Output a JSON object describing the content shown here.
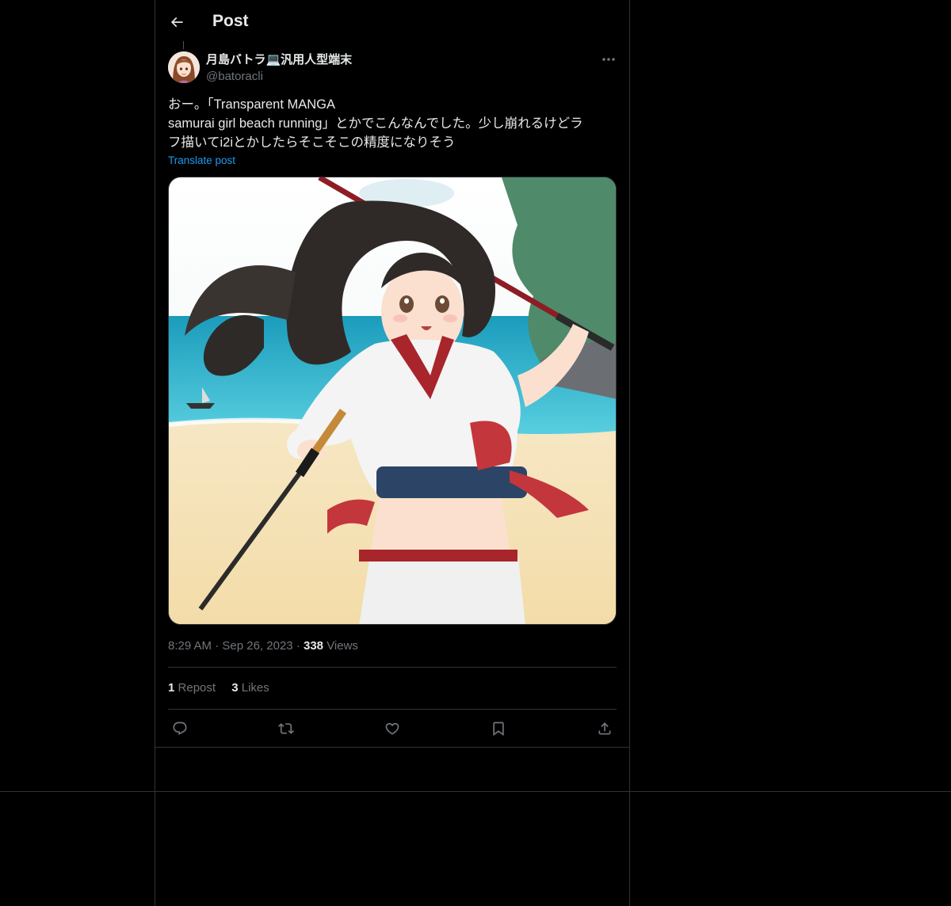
{
  "header": {
    "title": "Post",
    "back_icon": "arrow-left-icon"
  },
  "author": {
    "display_name": "月島バトラ💻汎用人型端末",
    "handle": "@batoracli"
  },
  "post": {
    "text_lines": [
      "おー。「Transparent MANGA",
      "samurai girl beach running」とかでこんなんでした。少し崩れるけどラ",
      "フ描いてi2iとかしたらそこそこの精度になりそう"
    ],
    "translate_label": "Translate post"
  },
  "meta": {
    "time": "8:29 AM",
    "date": "Sep 26, 2023",
    "separator": "·",
    "views_count": "338",
    "views_label": "Views"
  },
  "stats": {
    "reposts_count": "1",
    "reposts_label": "Repost",
    "likes_count": "3",
    "likes_label": "Likes"
  },
  "actions": [
    "reply-icon",
    "repost-icon",
    "like-icon",
    "bookmark-icon",
    "share-icon"
  ],
  "colors": {
    "background": "#000000",
    "text": "#e7e9ea",
    "muted": "#71767b",
    "accent": "#1d9bf0",
    "border": "#2f3336"
  }
}
